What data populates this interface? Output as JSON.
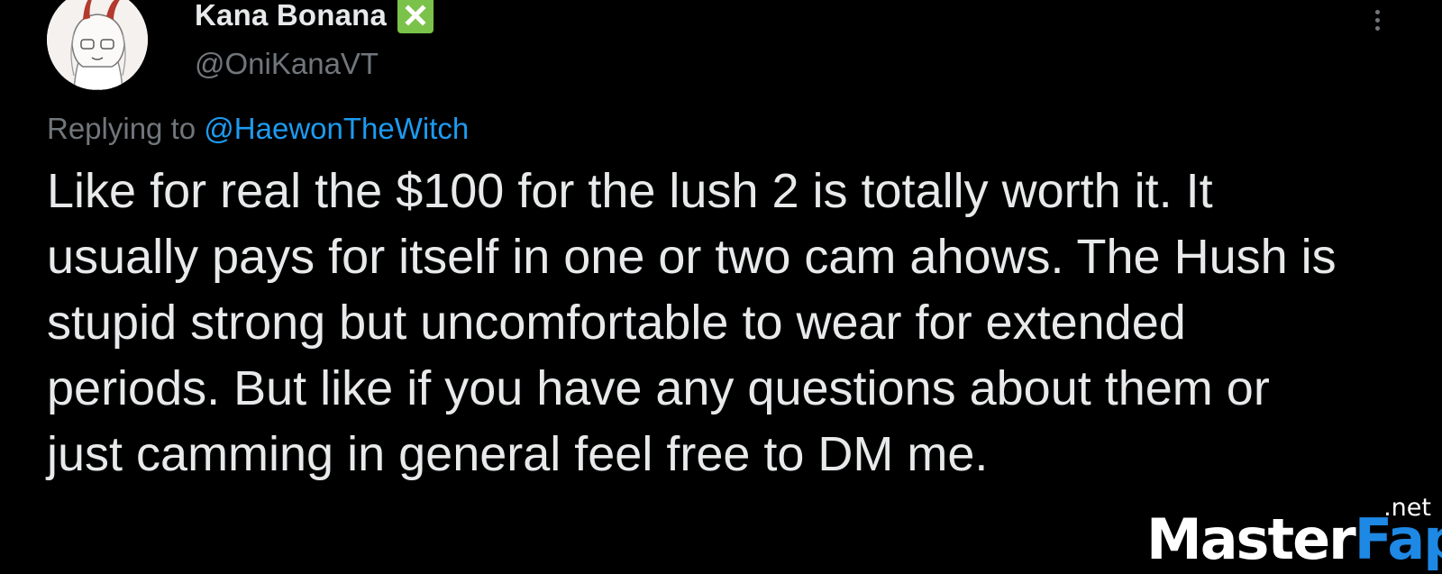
{
  "tweet": {
    "author": {
      "display_name": "Kana Bonana",
      "handle": "@OniKanaVT",
      "badge_icon": "green-cross-mark-emoji",
      "badge_color": "#7bc24a"
    },
    "replying_to": {
      "prefix": "Replying to",
      "mention": "@HaewonTheWitch"
    },
    "text": "Like for real the $100 for the lush 2 is totally worth it. It usually pays for itself in one or two cam ahows. The Hush is stupid strong but uncomfortable to wear for extended periods. But like if you have any questions about them or just camming in general feel free to DM me.",
    "more_icon": "vertical-ellipsis-icon"
  },
  "watermark": {
    "part1": "Master",
    "part2": "Fap",
    "suffix": ".net",
    "accent_color": "#1e88e5"
  },
  "colors": {
    "background": "#000000",
    "text": "#e7e9ea",
    "muted": "#71767b",
    "link": "#1d9bf0"
  }
}
